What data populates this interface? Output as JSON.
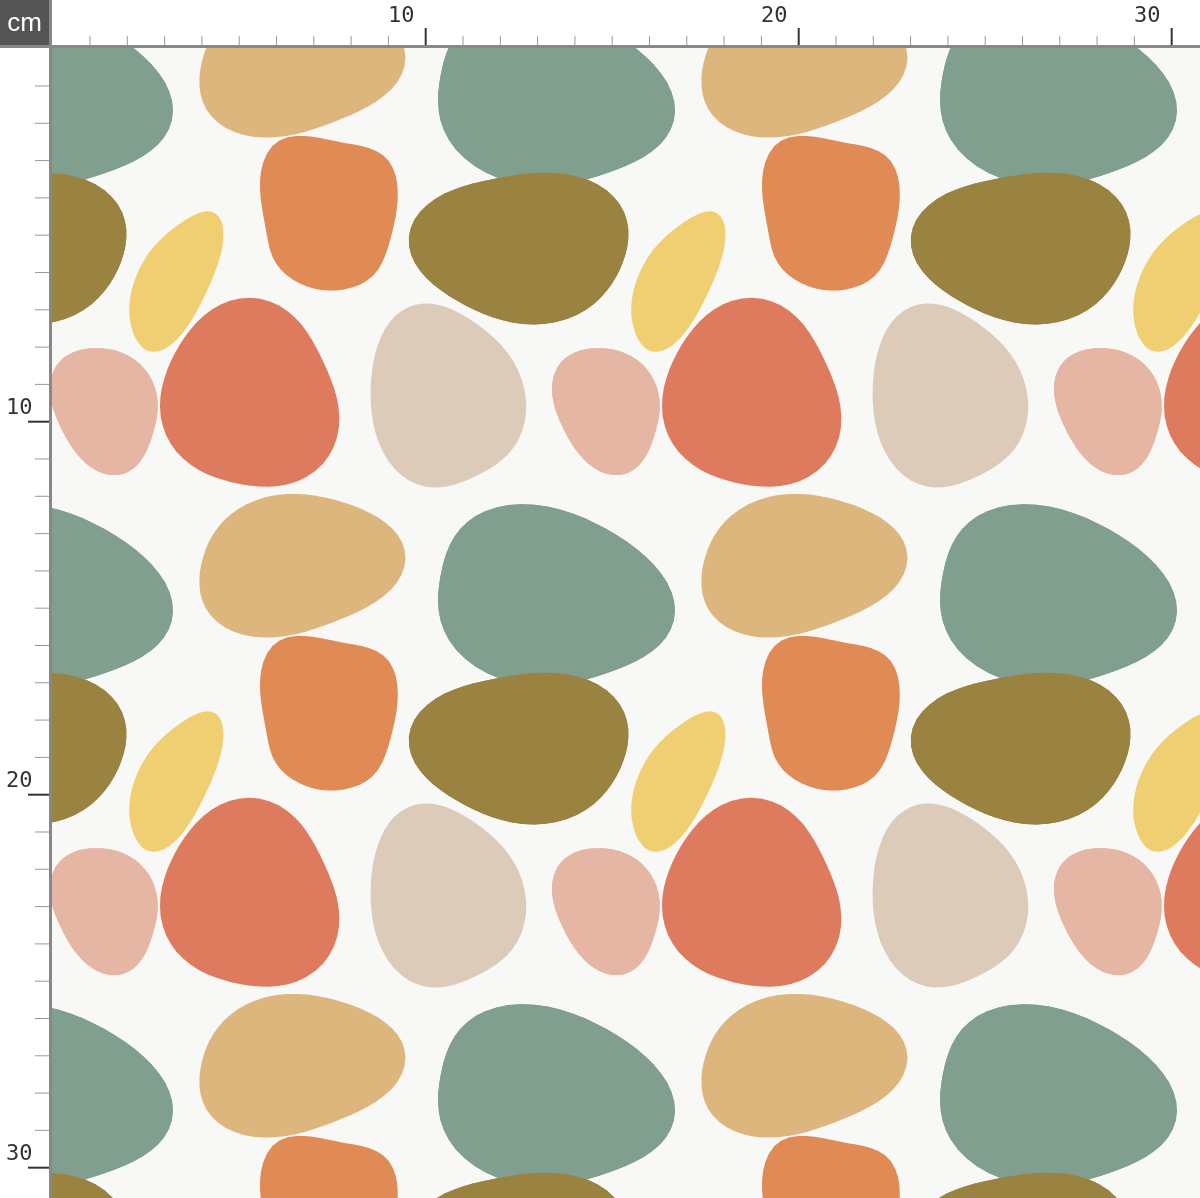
{
  "ruler": {
    "unit": "cm",
    "top_labels": [
      "10",
      "20",
      "30"
    ],
    "left_labels": [
      "10",
      "20",
      "30"
    ]
  }
}
